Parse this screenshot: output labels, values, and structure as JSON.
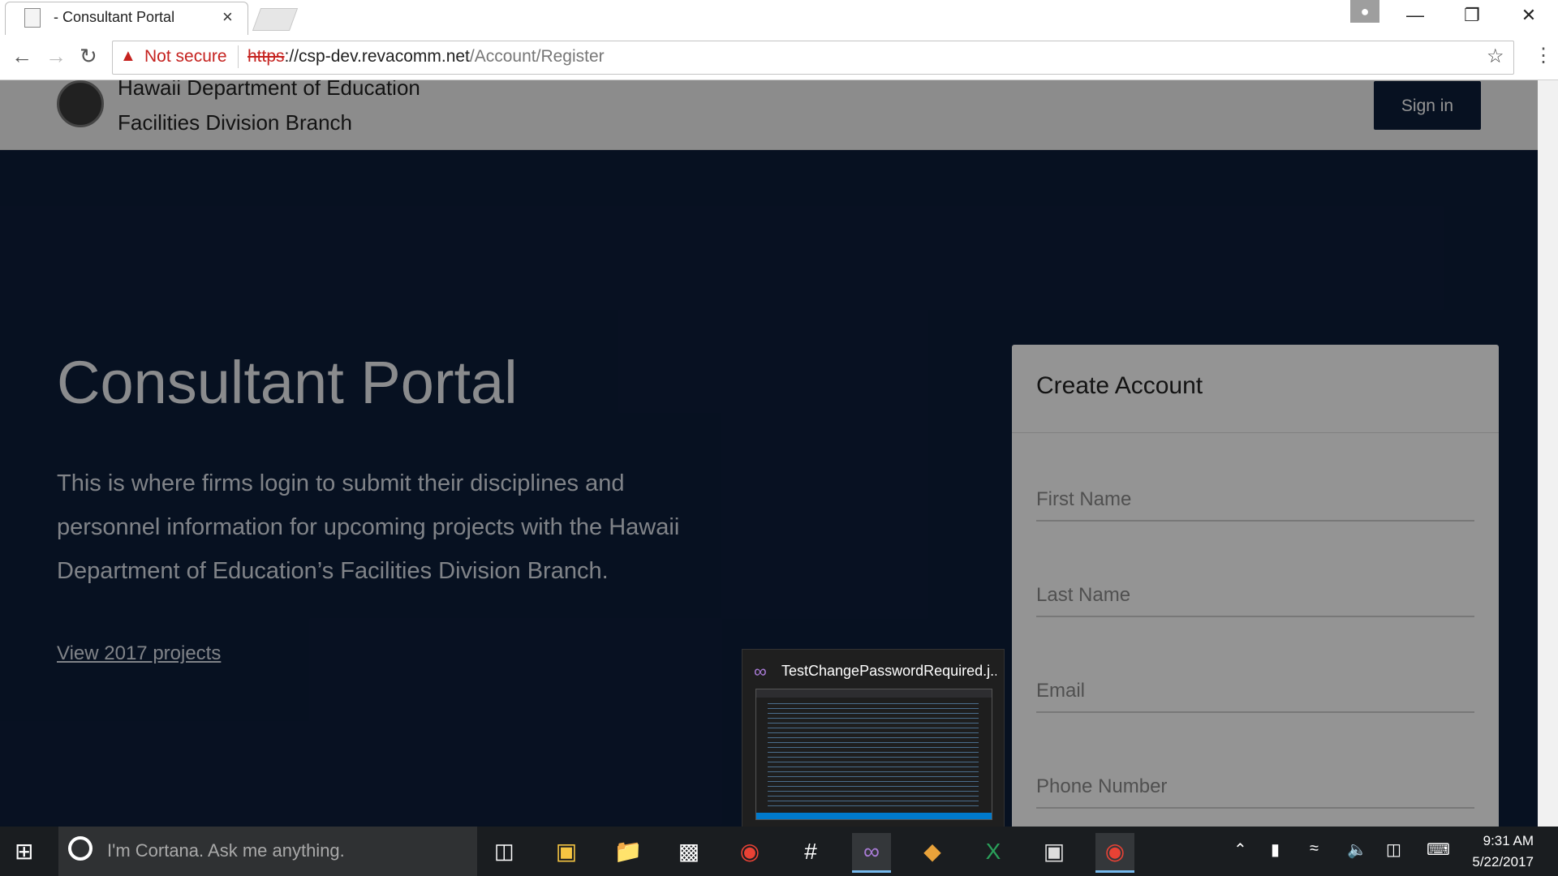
{
  "browser": {
    "tab_title": "- Consultant Portal",
    "tab_close": "×",
    "security_label": "Not secure",
    "url_scheme": "https",
    "url_host": "://csp-dev.revacomm.net",
    "url_path": "/Account/Register"
  },
  "header": {
    "org_line1": "Hawaii Department of Education",
    "org_line2": "Facilities Division Branch",
    "signin_label": "Sign in"
  },
  "hero": {
    "title": "Consultant Portal",
    "description": "This is where firms login to submit their disciplines and personnel information for upcoming projects with the Hawaii Department of Education’s Facilities Division Branch.",
    "link": "View 2017 projects"
  },
  "form": {
    "title": "Create Account",
    "fields": [
      {
        "placeholder": "First Name"
      },
      {
        "placeholder": "Last Name"
      },
      {
        "placeholder": "Email"
      },
      {
        "placeholder": "Phone Number"
      }
    ]
  },
  "thumbnail": {
    "title": "TestChangePasswordRequired.j..."
  },
  "taskbar": {
    "search_placeholder": "I'm Cortana. Ask me anything.",
    "apps": [
      "file-explorer-photos-icon",
      "file-explorer-icon",
      "store-icon",
      "chrome-icon",
      "slack-icon",
      "visual-studio-icon",
      "git-icon",
      "excel-icon",
      "terminal-icon",
      "chrome-icon"
    ],
    "time": "9:31 AM",
    "date": "5/22/2017"
  },
  "colors": {
    "page_background": "#0d1e3a",
    "signin_button": "#0d1e3a",
    "warning": "#c5221f"
  }
}
